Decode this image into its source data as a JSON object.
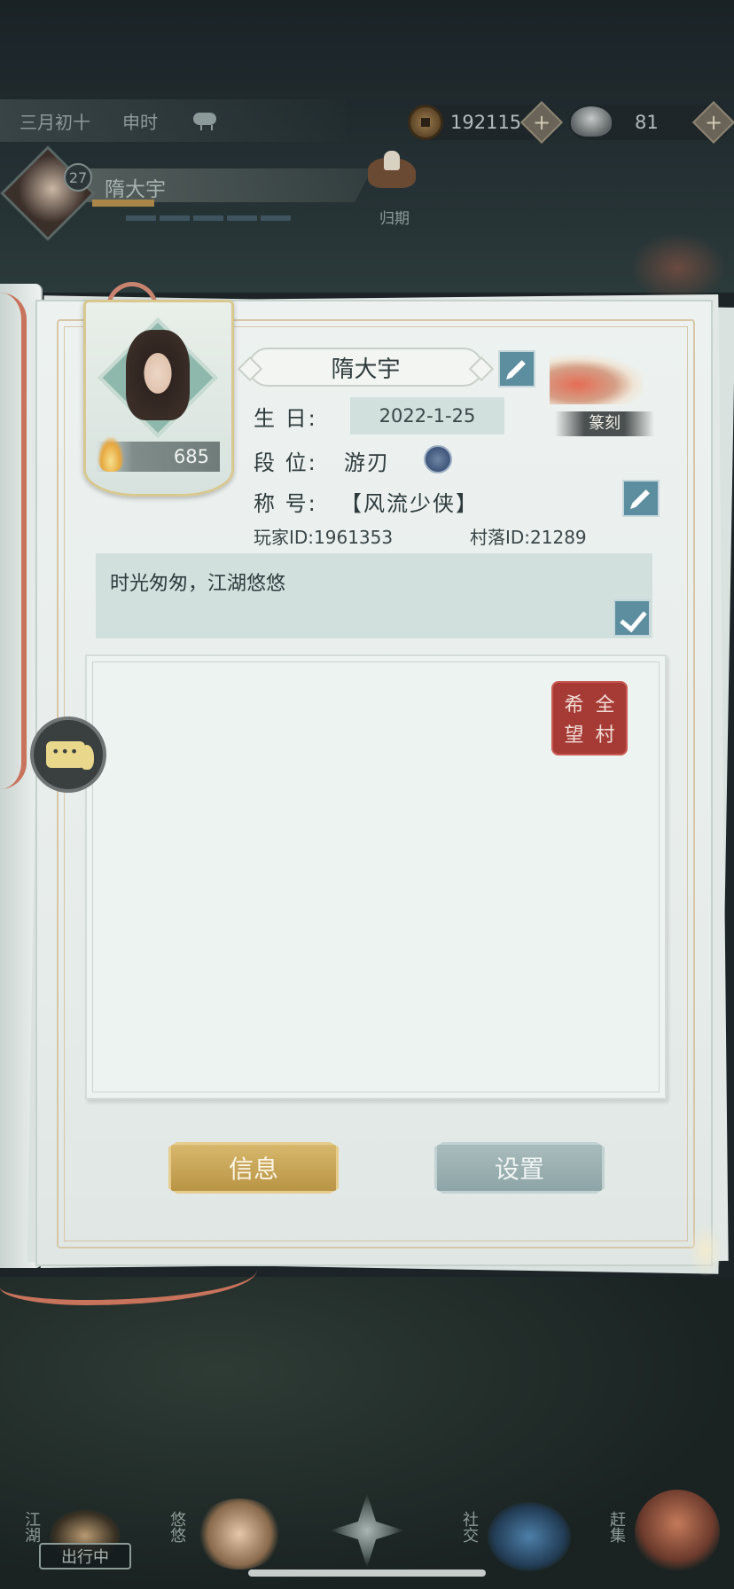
{
  "hud": {
    "date": "三月初十",
    "time": "申时",
    "weather_icon": "cloud-rain-icon",
    "copper_coins": "192115",
    "silver": "81",
    "add_label": "+"
  },
  "player": {
    "level": "27",
    "name": "隋大宇",
    "return_label": "归期"
  },
  "profile": {
    "name": "隋大宇",
    "power": "685",
    "birthday_label": "生    日:",
    "birthday": "2022-1-25",
    "rank_label": "段    位:",
    "rank": "游刃",
    "title_label": "称    号:",
    "title": "【风流少侠】",
    "player_id_text": "玩家ID:1961353",
    "village_id_text": "村落ID:21289",
    "seal_label": "篆刻",
    "motto": "时光匆匆，江湖悠悠",
    "stamp_chars": [
      "希",
      "全",
      "望",
      "村"
    ]
  },
  "tabs": {
    "info": "信息",
    "settings": "设置"
  },
  "bottom_nav": {
    "jianghu": "江湖",
    "yoyou": "悠悠",
    "social": "社交",
    "market": "赶集",
    "travel_badge": "出行中"
  },
  "colors": {
    "accent": "#5d8ea0",
    "gold_tab": "#c9a455",
    "stamp_red": "#a63b36"
  }
}
